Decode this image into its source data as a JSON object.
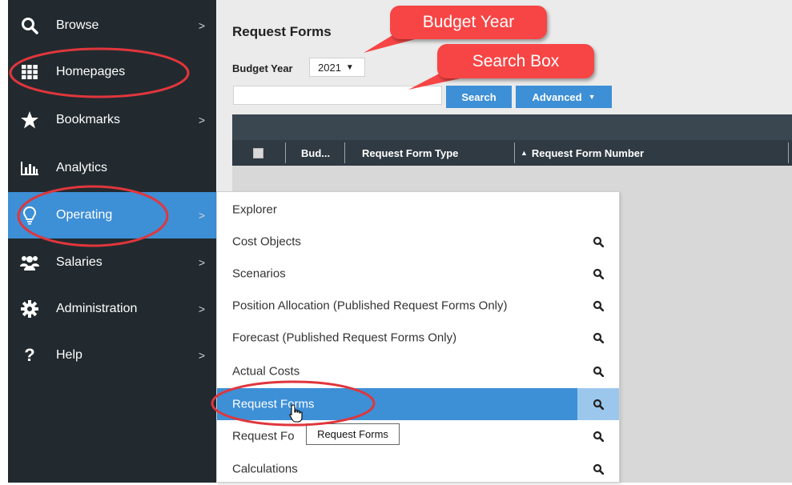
{
  "sidebar": {
    "items": [
      {
        "label": "Browse",
        "icon": "search-icon",
        "has_chevron": true
      },
      {
        "label": "Homepages",
        "icon": "grid-icon",
        "has_chevron": false
      },
      {
        "label": "Bookmarks",
        "icon": "star-icon",
        "has_chevron": true
      },
      {
        "label": "Analytics",
        "icon": "bar-chart-icon",
        "has_chevron": false
      },
      {
        "label": "Operating",
        "icon": "lightbulb-icon",
        "has_chevron": true,
        "active": true
      },
      {
        "label": "Salaries",
        "icon": "users-icon",
        "has_chevron": true
      },
      {
        "label": "Administration",
        "icon": "gear-icon",
        "has_chevron": true
      },
      {
        "label": "Help",
        "icon": "question-icon",
        "has_chevron": true
      }
    ],
    "chevron": ">"
  },
  "main": {
    "title": "Request Forms",
    "budget_year_label": "Budget Year",
    "budget_year_value": "2021",
    "search_value": "",
    "search_button": "Search",
    "advanced_button": "Advanced",
    "grid": {
      "columns": [
        "Bud...",
        "Request Form Type",
        "Request Form Number"
      ],
      "sort_indicator": "▲"
    }
  },
  "menu": {
    "items": [
      {
        "label": "Explorer",
        "has_search": false
      },
      {
        "label": "Cost Objects",
        "has_search": true
      },
      {
        "label": "Scenarios",
        "has_search": true
      },
      {
        "label": "Position Allocation (Published Request Forms Only)",
        "has_search": true
      },
      {
        "label": "Forecast (Published Request Forms Only)",
        "has_search": true
      },
      {
        "label": "Actual Costs",
        "has_search": true
      },
      {
        "label": "Request Forms",
        "has_search": true,
        "active": true
      },
      {
        "label": "Request Fo",
        "has_search": true
      },
      {
        "label": "Calculations",
        "has_search": true
      }
    ]
  },
  "tooltip": {
    "text": "Request Forms"
  },
  "callouts": {
    "budget_year": "Budget Year",
    "search_box": "Search Box"
  },
  "colors": {
    "sidebar_bg": "#222a2f",
    "accent_blue": "#3d8fd6",
    "callout_red": "#f74545",
    "annotation_ellipse": "#e0363c",
    "grid_header": "#2f3a43"
  }
}
